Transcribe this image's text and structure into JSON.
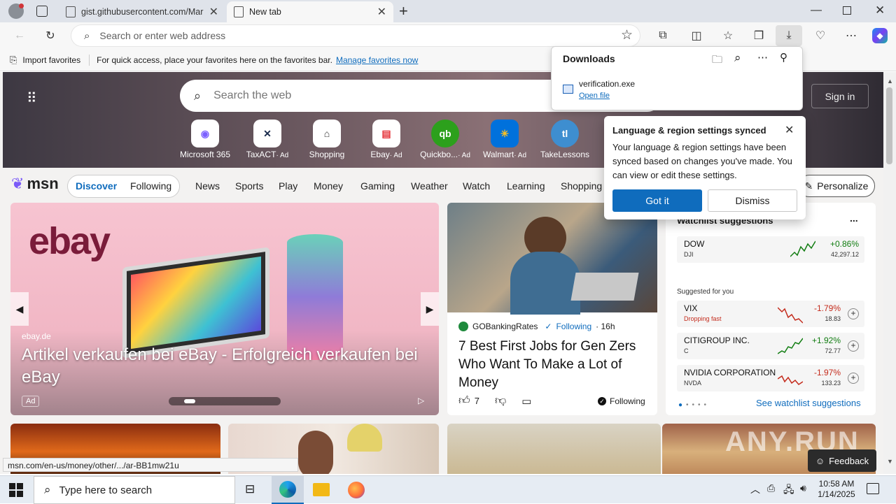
{
  "tabs": [
    {
      "title": "gist.githubusercontent.com/Mar"
    },
    {
      "title": "New tab"
    }
  ],
  "address": {
    "placeholder": "Search or enter web address"
  },
  "favorites_bar": {
    "import_label": "Import favorites",
    "hint": "For quick access, place your favorites here on the favorites bar.",
    "manage_link": "Manage favorites now"
  },
  "downloads": {
    "title": "Downloads",
    "file_name": "verification.exe",
    "open_label": "Open file"
  },
  "sync_popup": {
    "title": "Language & region settings synced",
    "body": "Your language & region settings have been synced based on changes you've made. You can view or edit these settings.",
    "primary": "Got it",
    "secondary": "Dismiss"
  },
  "msn": {
    "search_placeholder": "Search the web",
    "signin": "Sign in",
    "tiles": [
      {
        "label": "Microsoft 365",
        "ad": ""
      },
      {
        "label": "TaxACT",
        "ad": "· Ad"
      },
      {
        "label": "Shopping",
        "ad": ""
      },
      {
        "label": "Ebay",
        "ad": "· Ad"
      },
      {
        "label": "Quickbo...",
        "ad": "· Ad"
      },
      {
        "label": "Walmart",
        "ad": "· Ad"
      },
      {
        "label": "TakeLessons",
        "ad": ""
      }
    ],
    "logo": "msn",
    "pill": {
      "discover": "Discover",
      "following": "Following"
    },
    "nav": [
      "News",
      "Sports",
      "Play",
      "Money",
      "Gaming",
      "Weather",
      "Watch",
      "Learning",
      "Shopping"
    ],
    "personalize": "Personalize"
  },
  "ebay_card": {
    "brand": "ebay",
    "source": "ebay.de",
    "headline": "Artikel verkaufen bei eBay - Erfolgreich verkaufen bei eBay",
    "ad_badge": "Ad"
  },
  "news_card": {
    "source": "GOBankingRates",
    "following": "Following",
    "age": "· 16h",
    "headline": "7 Best First Jobs for Gen Zers Who Want To Make a Lot of Money",
    "likes": "7",
    "following_footer": "Following"
  },
  "watchlist": {
    "title": "Watchlist suggestions",
    "more": "...",
    "index": {
      "name": "DOW",
      "symbol": "DJI",
      "pct": "+0.86%",
      "price": "42,297.12"
    },
    "suggested_label": "Suggested for you",
    "items": [
      {
        "name": "VIX",
        "symbol": "Dropping fast",
        "pct": "-1.79%",
        "price": "18.83",
        "color": "#c42b1c"
      },
      {
        "name": "CITIGROUP INC.",
        "symbol": "C",
        "pct": "+1.92%",
        "price": "72.77",
        "color": "#107c10"
      },
      {
        "name": "NVIDIA CORPORATION",
        "symbol": "NVDA",
        "pct": "-1.97%",
        "price": "133.23",
        "color": "#c42b1c"
      }
    ],
    "see_more": "See watchlist suggestions"
  },
  "feedback": "Feedback",
  "watermark": "ANY.RUN",
  "status_url": "msn.com/en-us/money/other/.../ar-BB1mw21u",
  "taskbar": {
    "search_placeholder": "Type here to search",
    "time": "10:58 AM",
    "date": "1/14/2025"
  }
}
